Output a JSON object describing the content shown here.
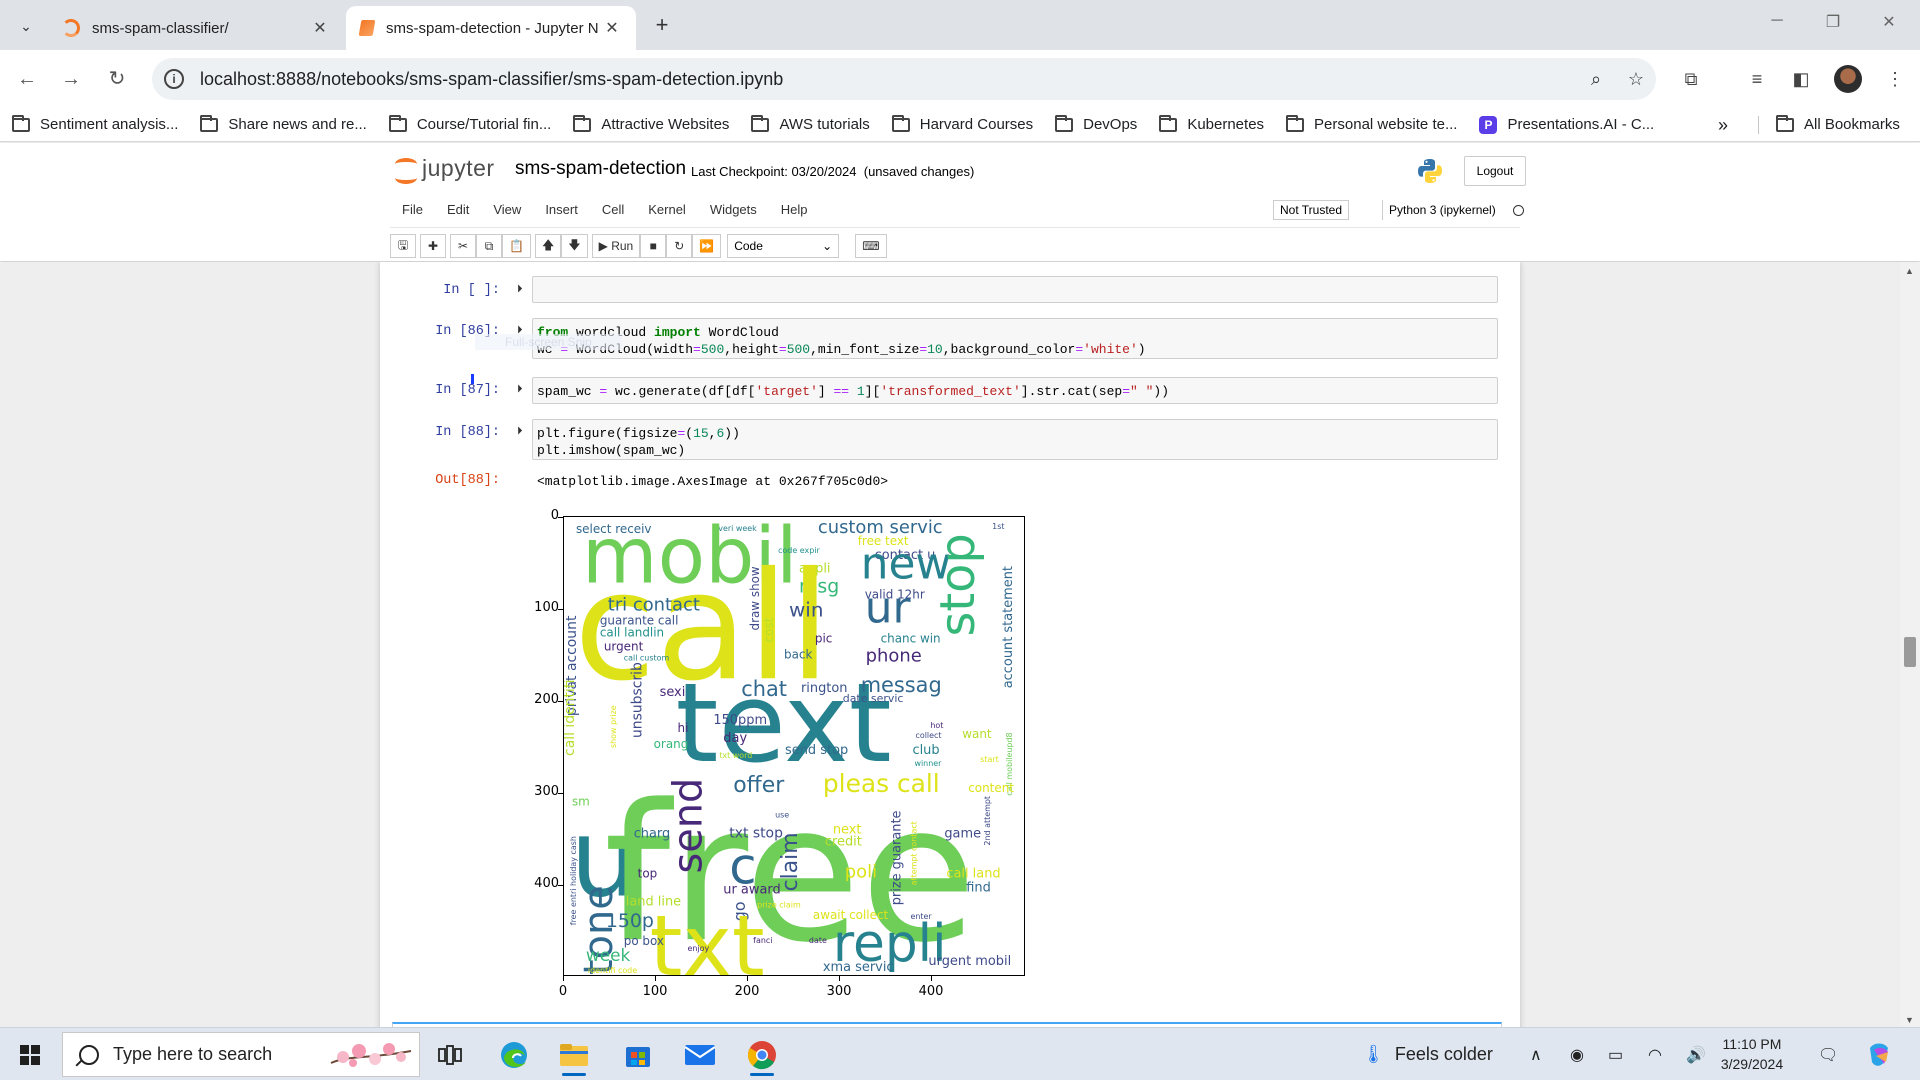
{
  "browser": {
    "tabs": [
      {
        "title": "sms-spam-classifier/",
        "active": false
      },
      {
        "title": "sms-spam-detection - Jupyter N",
        "active": true
      }
    ],
    "url": "localhost:8888/notebooks/sms-spam-classifier/sms-spam-detection.ipynb",
    "bookmarks": [
      "Sentiment analysis...",
      "Share news and re...",
      "Course/Tutorial fin...",
      "Attractive Websites",
      "AWS tutorials",
      "Harvard Courses",
      "DevOps",
      "Kubernetes",
      "Personal website te...",
      "Presentations.AI - C..."
    ],
    "all_bookmarks": "All Bookmarks"
  },
  "jupyter": {
    "logo_text": "jupyter",
    "notebook_name": "sms-spam-detection",
    "checkpoint": "Last Checkpoint: 03/20/2024",
    "unsaved": "(unsaved changes)",
    "logout": "Logout",
    "menu": [
      "File",
      "Edit",
      "View",
      "Insert",
      "Cell",
      "Kernel",
      "Widgets",
      "Help"
    ],
    "trust": "Not Trusted",
    "kernel": "Python 3 (ipykernel)",
    "run_label": "Run",
    "cell_type": "Code"
  },
  "cells": {
    "empty_prompt": "In [ ]:",
    "c86_prompt": "In [86]:",
    "c87_prompt": "In [87]:",
    "c88_prompt": "In [88]:",
    "out88_prompt": "Out[88]:",
    "out88_text": "<matplotlib.image.AxesImage at 0x267f705c0d0>",
    "snip_hint": "Full-screen Snip"
  },
  "figure": {
    "y_ticks": [
      "0",
      "100",
      "200",
      "300",
      "400"
    ],
    "x_ticks": [
      "0",
      "100",
      "200",
      "300",
      "400"
    ]
  },
  "taskbar": {
    "search_placeholder": "Type here to search",
    "weather": "Feels colder",
    "time": "11:10 PM",
    "date": "3/29/2024"
  }
}
